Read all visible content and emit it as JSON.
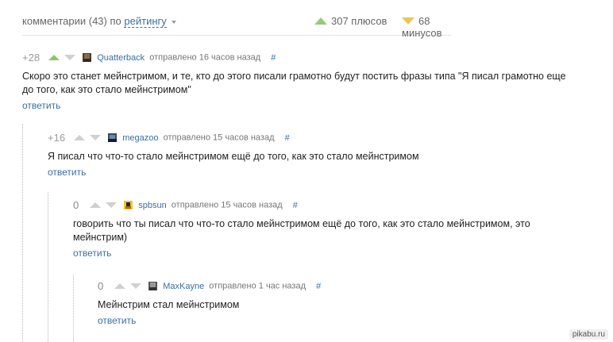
{
  "header": {
    "comments_label": "комментарии (43) по",
    "sort_label": "рейтингу",
    "plus_label": "307 плюсов",
    "minus_label": "68 минусов"
  },
  "comments": [
    {
      "score": "+28",
      "author": "Quatterback",
      "time": "отправлено 16 часов назад",
      "anchor": "#",
      "text": "Скоро это станет мейнстримом, и те, кто до этого писали грамотно будут постить фразы типа \"Я писал грамотно еще до того, как это стало мейнстримом\"",
      "reply": "ответить"
    },
    {
      "score": "+16",
      "author": "megazoo",
      "time": "отправлено 15 часов назад",
      "anchor": "#",
      "text": "Я писал что что-то стало мейнстримом ещё до того, как это стало мейнстримом",
      "reply": "ответить"
    },
    {
      "score": "0",
      "author": "spbsun",
      "time": "отправлено 15 часов назад",
      "anchor": "#",
      "text": "говорить что ты писал что что-то стало мейнстримом ещё до того, как это стало мейнстримом, это мейнстрим)",
      "reply": "ответить"
    },
    {
      "score": "0",
      "author": "MaxKayne",
      "time": "отправлено 1 час назад",
      "anchor": "#",
      "text": "Мейнстрим стал мейнстримом",
      "reply": "ответить"
    }
  ],
  "watermark": "pikabu.ru"
}
